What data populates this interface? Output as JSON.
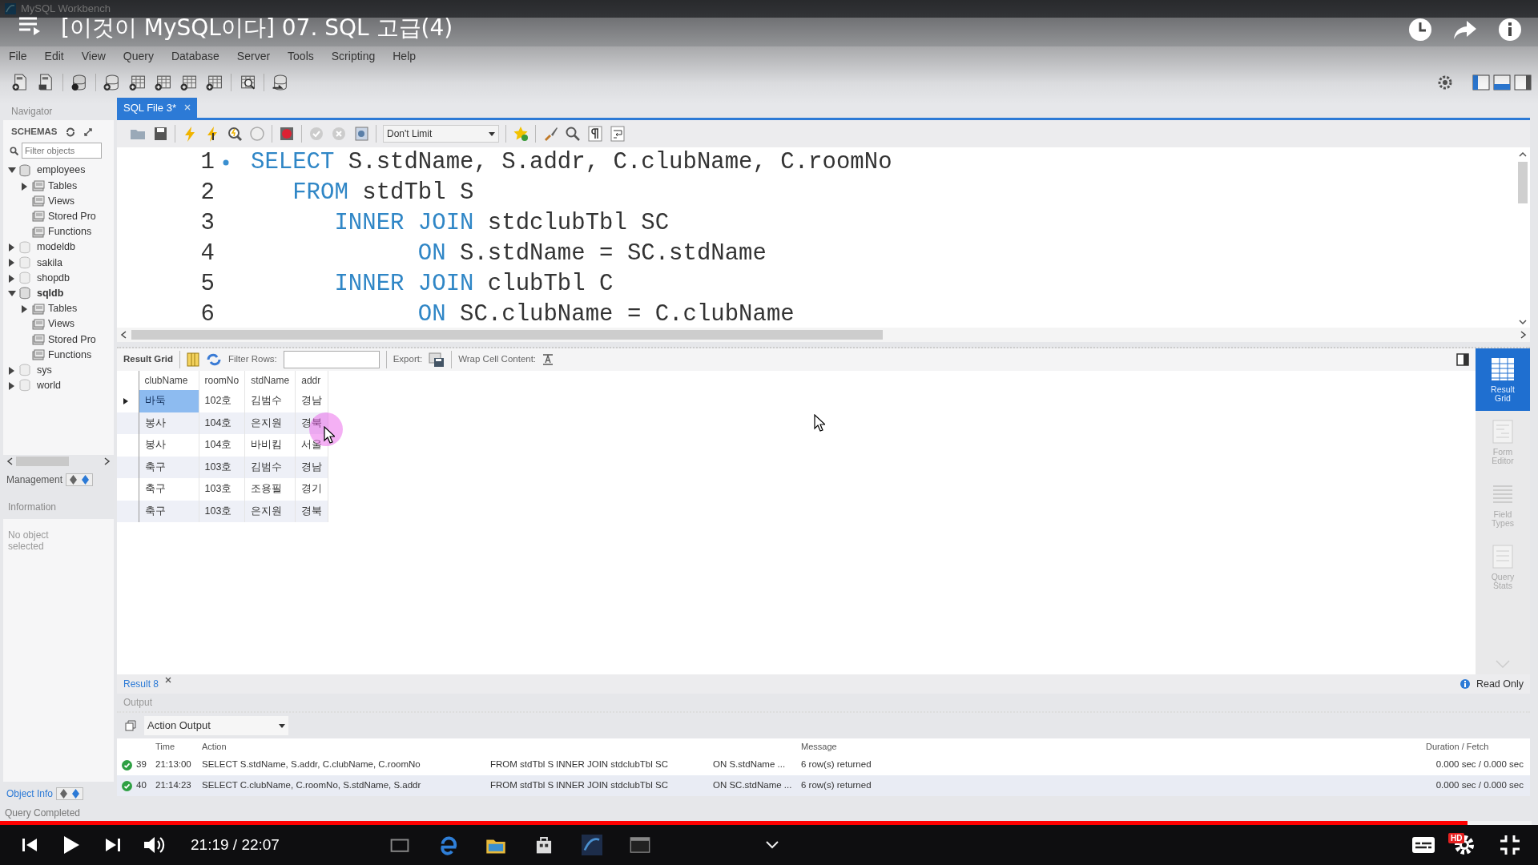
{
  "app": {
    "title": "MySQL Workbench"
  },
  "video": {
    "title": "[이것이 MySQL이다] 07. SQL 고급(4)",
    "time": "21:19 / 22:07",
    "level": 0.958,
    "hd": "HD"
  },
  "menu": [
    "File",
    "Edit",
    "View",
    "Query",
    "Database",
    "Server",
    "Tools",
    "Scripting",
    "Help"
  ],
  "navigator": {
    "title": "Navigator",
    "schemas": "SCHEMAS",
    "filter_placeholder": "Filter objects",
    "management": "Management",
    "information": "Information",
    "info_text": "No object selected",
    "object_info": "Object Info",
    "tree": [
      {
        "label": "employees",
        "expanded": true,
        "default": false,
        "children": [
          {
            "label": "Tables",
            "expandable": true
          },
          {
            "label": "Views",
            "expandable": false
          },
          {
            "label": "Stored Pro",
            "expandable": false
          },
          {
            "label": "Functions",
            "expandable": false
          }
        ]
      },
      {
        "label": "modeldb",
        "expanded": false,
        "default": false
      },
      {
        "label": "sakila",
        "expanded": false,
        "default": false
      },
      {
        "label": "shopdb",
        "expanded": false,
        "default": false
      },
      {
        "label": "sqldb",
        "expanded": true,
        "default": true,
        "children": [
          {
            "label": "Tables",
            "expandable": true
          },
          {
            "label": "Views",
            "expandable": false
          },
          {
            "label": "Stored Pro",
            "expandable": false
          },
          {
            "label": "Functions",
            "expandable": false
          }
        ]
      },
      {
        "label": "sys",
        "expanded": false,
        "default": false
      },
      {
        "label": "world",
        "expanded": false,
        "default": false
      }
    ]
  },
  "editor": {
    "tab": "SQL File 3*",
    "limit": "Don't Limit",
    "lines": [
      {
        "number": "1",
        "marker": true,
        "tokens": [
          {
            "kind": "keyword",
            "text": "SELECT"
          },
          {
            "kind": "plain",
            "text": " S.stdName, S.addr, C.clubName, C.roomNo"
          }
        ]
      },
      {
        "number": "2",
        "marker": false,
        "tokens": [
          {
            "kind": "keyword",
            "text": "   FROM"
          },
          {
            "kind": "plain",
            "text": " stdTbl S"
          }
        ]
      },
      {
        "number": "3",
        "marker": false,
        "tokens": [
          {
            "kind": "keyword",
            "text": "      INNER JOIN"
          },
          {
            "kind": "plain",
            "text": " stdclubTbl SC"
          }
        ]
      },
      {
        "number": "4",
        "marker": false,
        "tokens": [
          {
            "kind": "keyword",
            "text": "            ON"
          },
          {
            "kind": "plain",
            "text": " S.stdName = SC.stdName"
          }
        ]
      },
      {
        "number": "5",
        "marker": false,
        "tokens": [
          {
            "kind": "keyword",
            "text": "      INNER JOIN"
          },
          {
            "kind": "plain",
            "text": " clubTbl C"
          }
        ]
      },
      {
        "number": "6",
        "marker": false,
        "tokens": [
          {
            "kind": "keyword",
            "text": "            ON"
          },
          {
            "kind": "plain",
            "text": " SC.clubName = C.clubName"
          }
        ]
      }
    ]
  },
  "result": {
    "grid_label": "Result Grid",
    "filter_label": "Filter Rows:",
    "export_label": "Export:",
    "wrap_label": "Wrap Cell Content:",
    "columns": [
      "clubName",
      "roomNo",
      "stdName",
      "addr"
    ],
    "rows": [
      {
        "selected": true,
        "cells": [
          "바둑",
          "102호",
          "김범수",
          "경남"
        ]
      },
      {
        "selected": false,
        "cells": [
          "봉사",
          "104호",
          "은지원",
          "경북"
        ]
      },
      {
        "selected": false,
        "cells": [
          "봉사",
          "104호",
          "바비킴",
          "서울"
        ]
      },
      {
        "selected": false,
        "cells": [
          "축구",
          "103호",
          "김범수",
          "경남"
        ]
      },
      {
        "selected": false,
        "cells": [
          "축구",
          "103호",
          "조용필",
          "경기"
        ]
      },
      {
        "selected": false,
        "cells": [
          "축구",
          "103호",
          "은지원",
          "경북"
        ]
      }
    ],
    "views": [
      {
        "label": "Result Grid",
        "selected": true
      },
      {
        "label": "Form Editor",
        "selected": false
      },
      {
        "label": "Field Types",
        "selected": false
      },
      {
        "label": "Query Stats",
        "selected": false
      }
    ],
    "tab": "Result 8",
    "read_only": "Read Only"
  },
  "output": {
    "title": "Output",
    "selector": "Action Output",
    "columns": [
      "Time",
      "Action",
      "Message",
      "Duration / Fetch"
    ],
    "rows": [
      {
        "selected": false,
        "number": "39",
        "time": "21:13:00",
        "action": [
          "SELECT S.stdName, S.addr, C.clubName, C.roomNo",
          "FROM stdTbl S",
          "INNER JOIN stdclubTbl SC",
          "ON S.stdName ..."
        ],
        "message": "6 row(s) returned",
        "duration": "0.000 sec / 0.000 sec"
      },
      {
        "selected": true,
        "number": "40",
        "time": "21:14:23",
        "action": [
          "SELECT C.clubName, C.roomNo, S.stdName, S.addr",
          "FROM  stdTbl S",
          "INNER JOIN stdclubTbl SC",
          "ON SC.stdName ..."
        ],
        "message": "6 row(s) returned",
        "duration": "0.000 sec / 0.000 sec"
      }
    ]
  },
  "status": "Query Completed"
}
